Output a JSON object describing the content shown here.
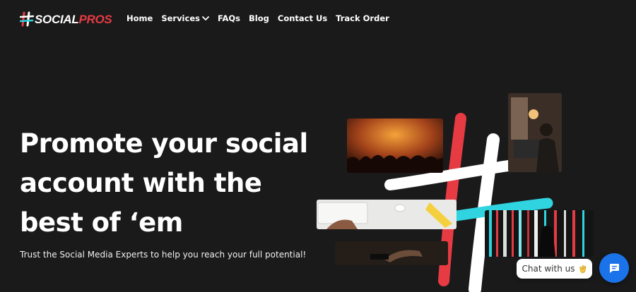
{
  "brand": {
    "name_part1": "SOCIAL",
    "name_part2": "PROS",
    "mark_icon": "hashtag-icon",
    "accent": "#e63b43",
    "secondary_accent": "#2fd4e0"
  },
  "nav": {
    "items": [
      {
        "label": "Home"
      },
      {
        "label": "Services",
        "icon": "chevron-down-icon"
      },
      {
        "label": "FAQs"
      },
      {
        "label": "Blog"
      },
      {
        "label": "Contact Us"
      },
      {
        "label": "Track Order"
      }
    ]
  },
  "hero": {
    "title_line1": "Promote your social",
    "title_line2": "account with the",
    "title_line3": "best of ‘em",
    "subtitle": "Trust the Social Media Experts to help you reach your full potential!"
  },
  "chat": {
    "bubble_text": "Chat with us",
    "bubble_icon": "waving-hand-icon",
    "button_icon": "chat-icon",
    "button_color": "#1a73e8"
  },
  "colors": {
    "background": "#1b1a1b",
    "text": "#ffffff"
  }
}
